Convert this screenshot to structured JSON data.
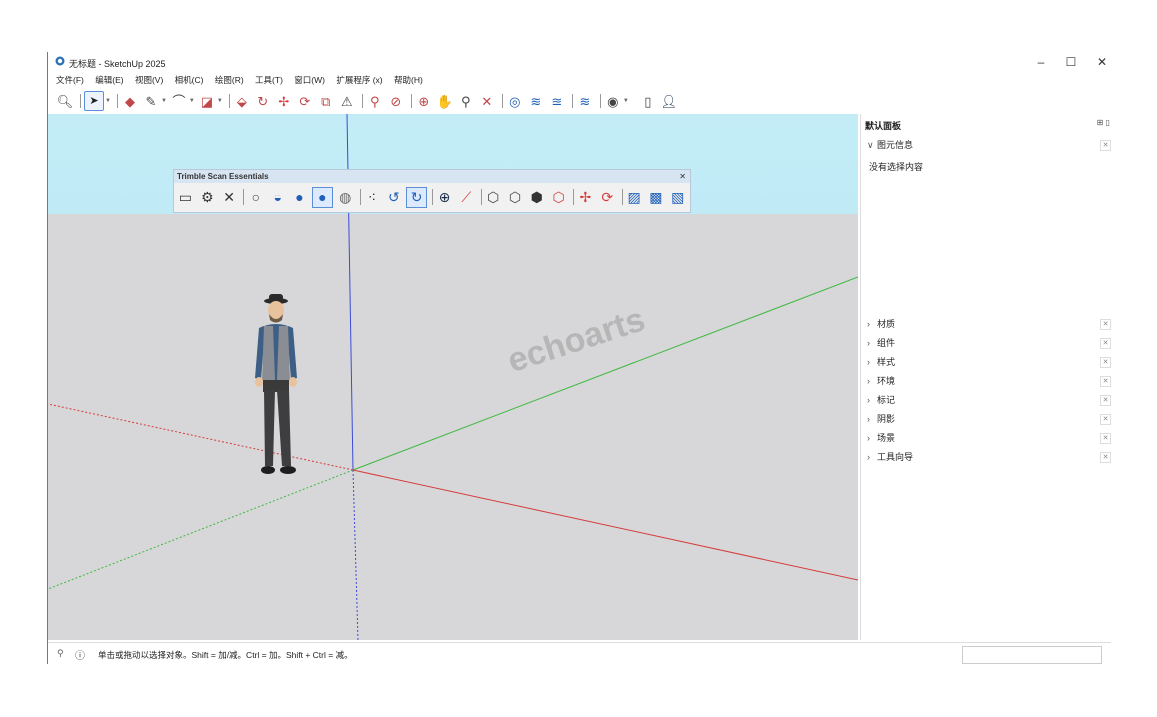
{
  "window": {
    "title": "无标题 - SketchUp 2025",
    "minimize": "–",
    "maximize": "☐",
    "close": "✕"
  },
  "menu": [
    "文件(F)",
    "编辑(E)",
    "视图(V)",
    "相机(C)",
    "绘图(R)",
    "工具(T)",
    "窗口(W)",
    "扩展程序 (x)",
    "帮助(H)"
  ],
  "floating_toolbar": {
    "title": "Trimble Scan Essentials",
    "close": "✕"
  },
  "watermark": "echoarts",
  "panel": {
    "title": "默认面板",
    "entity_info": "图元信息",
    "empty_text": "没有选择内容",
    "sections": [
      "材质",
      "组件",
      "样式",
      "环境",
      "标记",
      "阴影",
      "场景",
      "工具向导"
    ]
  },
  "status": {
    "message": "单击或拖动以选择对象。Shift = 加/减。Ctrl = 加。Shift + Ctrl = 减。"
  },
  "colors": {
    "sky": "#b4e6f4",
    "ground": "#d7d7d9",
    "axis_red": "#d63b3b",
    "axis_green": "#3cb83c",
    "axis_blue": "#3b4bd6",
    "accent_blue": "#1f5fb8"
  }
}
